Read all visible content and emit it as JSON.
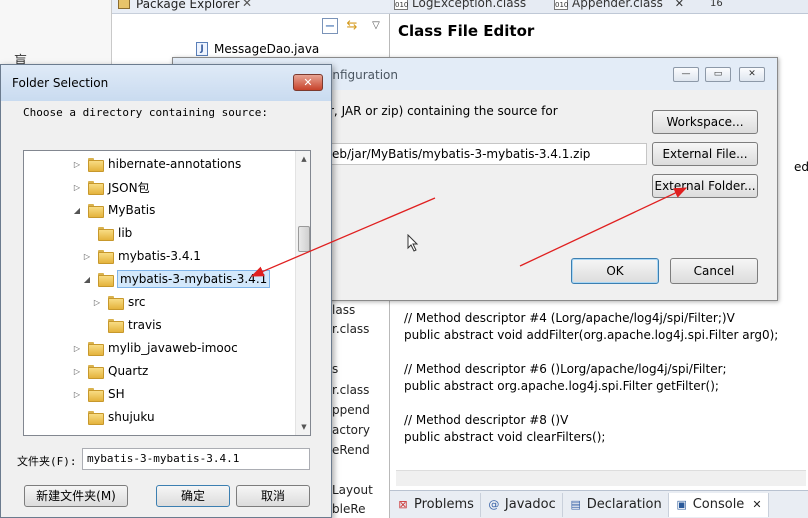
{
  "eclipse": {
    "package_explorer": {
      "title": "Package Explorer",
      "close": "✕",
      "java_file": "MessageDao.java"
    },
    "editor_tabs": [
      {
        "label": "LogException.class",
        "close": ""
      },
      {
        "label": "Appender.class",
        "close": "✕"
      },
      {
        "label": "16",
        "close": ""
      }
    ],
    "editor_title": "Class File Editor",
    "side_text": "ed",
    "code_lines": [
      "// Method descriptor #4 (Lorg/apache/log4j/spi/Filter;)V",
      "public abstract void addFilter(org.apache.log4j.spi.Filter arg0);",
      "",
      "// Method descriptor #6 ()Lorg/apache/log4j/spi/Filter;",
      "public abstract org.apache.log4j.spi.Filter getFilter();",
      "",
      "// Method descriptor #8 ()V",
      "public abstract void clearFilters();"
    ],
    "peek_labels": [
      "lass",
      "r.class",
      "s",
      "r.class",
      "ppend",
      "actory",
      "eRend",
      "Layout",
      "bleRe"
    ],
    "left_glyph": "盲",
    "bottom_tabs": [
      {
        "label": "Problems",
        "icon": "problems-icon"
      },
      {
        "label": "Javadoc",
        "icon": "at-icon"
      },
      {
        "label": "Declaration",
        "icon": "declaration-icon"
      },
      {
        "label": "Console",
        "icon": "console-icon",
        "close": "✕"
      }
    ]
  },
  "config_dialog": {
    "title": "onfiguration",
    "description": "r, JAR or zip) containing the source for",
    "path_value": "eb/jar/MyBatis/mybatis-3-mybatis-3.4.1.zip",
    "buttons": {
      "workspace": "Workspace...",
      "external_file": "External File...",
      "external_folder": "External Folder...",
      "ok": "OK",
      "cancel": "Cancel"
    },
    "window_controls": {
      "minimize": "—",
      "maximize": "▭",
      "close": "✕"
    }
  },
  "folder_dialog": {
    "title": "Folder Selection",
    "close": "✕",
    "prompt": "Choose a directory containing source:",
    "tree": [
      {
        "label": "hibernate-annotations",
        "level": 0,
        "expander": "▷"
      },
      {
        "label": "JSON包",
        "level": 0,
        "expander": "▷"
      },
      {
        "label": "MyBatis",
        "level": 0,
        "expander": "◢"
      },
      {
        "label": "lib",
        "level": 1,
        "expander": ""
      },
      {
        "label": "mybatis-3.4.1",
        "level": 1,
        "expander": "▷"
      },
      {
        "label": "mybatis-3-mybatis-3.4.1",
        "level": 1,
        "expander": "◢",
        "selected": true
      },
      {
        "label": "src",
        "level": 2,
        "expander": "▷"
      },
      {
        "label": "travis",
        "level": 2,
        "expander": ""
      },
      {
        "label": "mylib_javaweb-imooc",
        "level": 0,
        "expander": "▷"
      },
      {
        "label": "Quartz",
        "level": 0,
        "expander": "▷"
      },
      {
        "label": "SH",
        "level": 0,
        "expander": "▷"
      },
      {
        "label": "shujuku",
        "level": 0,
        "expander": ""
      }
    ],
    "folder_label": "文件夹(F):",
    "folder_value": "mybatis-3-mybatis-3.4.1",
    "buttons": {
      "new_folder": "新建文件夹(M)",
      "confirm": "确定",
      "cancel": "取消"
    }
  },
  "colors": {
    "accent": "#3c7fb1",
    "annotation": "#e02020",
    "selection": "#d3e8fb"
  }
}
